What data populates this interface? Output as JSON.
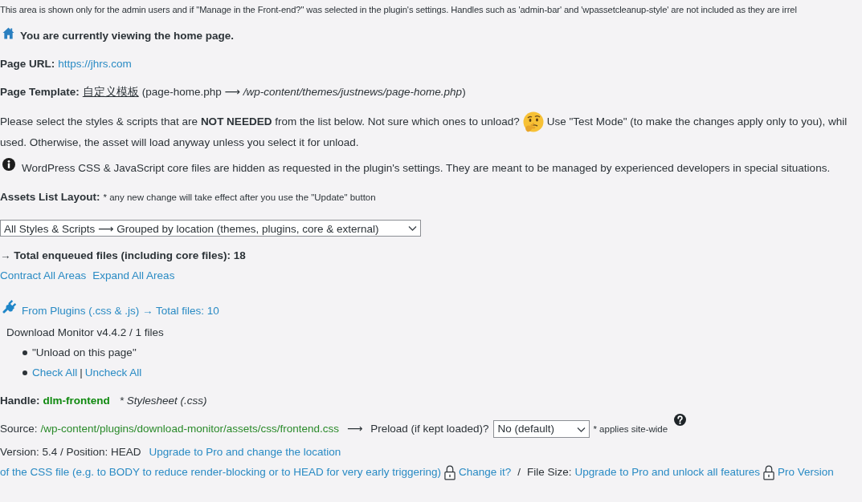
{
  "notice": "This area is shown only for the admin users and if \"Manage in the Front-end?\" was selected in the plugin's settings. Handles such as 'admin-bar' and 'wpassetcleanup-style' are not included as they are irrel",
  "current_page": "You are currently viewing the home page.",
  "page_url": {
    "label": "Page URL:",
    "link": "https://jhrs.com"
  },
  "page_template": {
    "label": "Page Template:",
    "name": "自定义模板",
    "detail": "(page-home.php  ⟶  */wp-content/themes/justnews/page-home.php*)"
  },
  "instructions": {
    "before_icon": "Please select the styles & scripts that are **NOT NEEDED** from the list below. Not sure which ones to unload?",
    "after_icon": "Use \"Test Mode\" (to make the changes apply only to you), whil",
    "continued": "used. Otherwise, the asset will load anyway unless you select it for unload."
  },
  "core_files_note": "WordPress CSS & JavaScript core files are hidden as requested in the plugin's settings. They are meant to be managed by experienced developers in special situations.",
  "layout": {
    "label": "Assets List Layout:",
    "note": "* any new change will take effect after you use the \"Update\" button",
    "select_value": "All Styles & Scripts ⟶ Grouped by location (themes, plugins, core & external)"
  },
  "total_files": "→ Total enqueued files (including core files): 18",
  "area_links": [
    "Contract All Areas",
    "Expand All Areas"
  ],
  "group": {
    "title": "From Plugins (.css & .js) → Total files: 10",
    "plugin": "Download Monitor v4.4.2 / 1 files",
    "items": [
      {
        "kind": "text",
        "text": "\"Unload on this page\""
      },
      {
        "kind": "links",
        "links": [
          "Check All",
          "Uncheck All"
        ],
        "separator": "|"
      }
    ]
  },
  "asset": {
    "handle_label": "Handle:",
    "handle": "dlm-frontend",
    "type": "* Stylesheet (.css)",
    "source_label": "Source:",
    "source_path": "/wp-content/plugins/download-monitor/assets/css/frontend.css",
    "arrow": "⟶",
    "preload_label": "Preload (if kept loaded)?",
    "preload_value": "No (default)",
    "preload_note": "* applies site-wide",
    "version": "Version: 5.4 / Position: HEAD",
    "position_upgrade": [
      "Upgrade to Pro and change the location",
      "of the CSS file (e.g. to BODY to reduce render-blocking or to HEAD for very early triggering)"
    ],
    "position_change": "Change it?",
    "separator": "/",
    "file_size_label": "File Size:",
    "file_size_upgrade": "Upgrade to Pro and unlock all features",
    "pro_link": "Pro Version"
  }
}
